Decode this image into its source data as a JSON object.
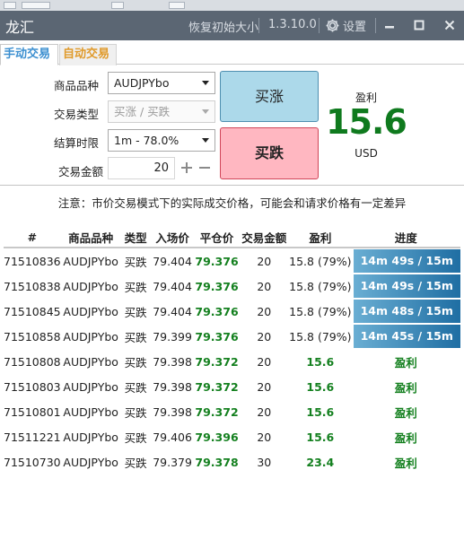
{
  "window": {
    "title": "龙汇",
    "reset_label": "恢复初始大小",
    "version": "1.3.10.0",
    "settings_label": "设置"
  },
  "tabs": [
    {
      "label": "手动交易",
      "active": true,
      "color": "#3c8fd0"
    },
    {
      "label": "自动交易",
      "active": false,
      "color": "#e09a2a"
    }
  ],
  "form": {
    "product": {
      "label": "商品品种",
      "value": "AUDJPYbo"
    },
    "trade_type": {
      "label": "交易类型",
      "value": "买涨 / 买跌"
    },
    "expiry": {
      "label": "结算时限",
      "value": "1m - 78.0%"
    },
    "amount": {
      "label": "交易金额",
      "value": "20"
    }
  },
  "buttons": {
    "buy_up": "买涨",
    "buy_down": "买跌"
  },
  "profit": {
    "label": "盈利",
    "value": "15.6",
    "unit": "USD"
  },
  "notice": "注意：市价交易模式下的实际成交价格，可能会和请求价格有一定差异",
  "table": {
    "headers": [
      "#",
      "商品品种",
      "类型",
      "入场价",
      "平仓价",
      "交易金额",
      "盈利",
      "进度"
    ],
    "rows": [
      {
        "id": "71510836",
        "symbol": "AUDJPYbo",
        "type": "买跌",
        "entry": "79.404",
        "close": "79.376",
        "amount": "20",
        "profit": "15.8 (79%)",
        "progress": "14m 49s / 15m",
        "status": "active"
      },
      {
        "id": "71510838",
        "symbol": "AUDJPYbo",
        "type": "买跌",
        "entry": "79.404",
        "close": "79.376",
        "amount": "20",
        "profit": "15.8 (79%)",
        "progress": "14m 49s / 15m",
        "status": "active"
      },
      {
        "id": "71510845",
        "symbol": "AUDJPYbo",
        "type": "买跌",
        "entry": "79.404",
        "close": "79.376",
        "amount": "20",
        "profit": "15.8 (79%)",
        "progress": "14m 48s / 15m",
        "status": "active"
      },
      {
        "id": "71510858",
        "symbol": "AUDJPYbo",
        "type": "买跌",
        "entry": "79.399",
        "close": "79.376",
        "amount": "20",
        "profit": "15.8 (79%)",
        "progress": "14m 45s / 15m",
        "status": "active"
      },
      {
        "id": "71510808",
        "symbol": "AUDJPYbo",
        "type": "买跌",
        "entry": "79.398",
        "close": "79.372",
        "amount": "20",
        "profit": "15.6",
        "progress": "盈利",
        "status": "done"
      },
      {
        "id": "71510803",
        "symbol": "AUDJPYbo",
        "type": "买跌",
        "entry": "79.398",
        "close": "79.372",
        "amount": "20",
        "profit": "15.6",
        "progress": "盈利",
        "status": "done"
      },
      {
        "id": "71510801",
        "symbol": "AUDJPYbo",
        "type": "买跌",
        "entry": "79.398",
        "close": "79.372",
        "amount": "20",
        "profit": "15.6",
        "progress": "盈利",
        "status": "done"
      },
      {
        "id": "71511221",
        "symbol": "AUDJPYbo",
        "type": "买跌",
        "entry": "79.406",
        "close": "79.396",
        "amount": "20",
        "profit": "15.6",
        "progress": "盈利",
        "status": "done"
      },
      {
        "id": "71510730",
        "symbol": "AUDJPYbo",
        "type": "买跌",
        "entry": "79.379",
        "close": "79.378",
        "amount": "30",
        "profit": "23.4",
        "progress": "盈利",
        "status": "done"
      }
    ]
  },
  "colors": {
    "titlebar": "#5b6673",
    "buy_up_bg": "#acd9ea",
    "buy_down_bg": "#ffb7c1",
    "profit_green": "#14801f",
    "progress_bar_left": "#6aaed3",
    "progress_bar_right": "#1f6ea3"
  }
}
